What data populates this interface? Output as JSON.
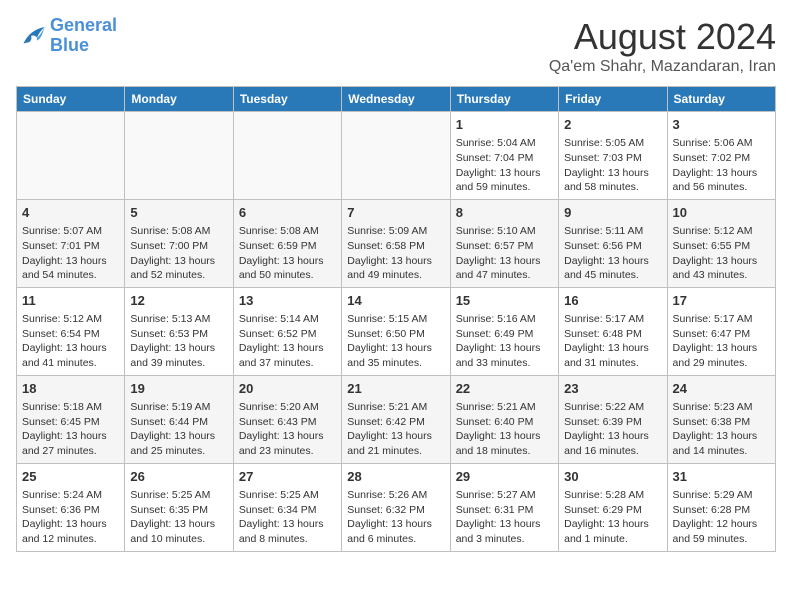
{
  "logo": {
    "line1": "General",
    "line2": "Blue"
  },
  "title": "August 2024",
  "location": "Qa'em Shahr, Mazandaran, Iran",
  "headers": [
    "Sunday",
    "Monday",
    "Tuesday",
    "Wednesday",
    "Thursday",
    "Friday",
    "Saturday"
  ],
  "weeks": [
    [
      {
        "day": "",
        "content": ""
      },
      {
        "day": "",
        "content": ""
      },
      {
        "day": "",
        "content": ""
      },
      {
        "day": "",
        "content": ""
      },
      {
        "day": "1",
        "content": "Sunrise: 5:04 AM\nSunset: 7:04 PM\nDaylight: 13 hours\nand 59 minutes."
      },
      {
        "day": "2",
        "content": "Sunrise: 5:05 AM\nSunset: 7:03 PM\nDaylight: 13 hours\nand 58 minutes."
      },
      {
        "day": "3",
        "content": "Sunrise: 5:06 AM\nSunset: 7:02 PM\nDaylight: 13 hours\nand 56 minutes."
      }
    ],
    [
      {
        "day": "4",
        "content": "Sunrise: 5:07 AM\nSunset: 7:01 PM\nDaylight: 13 hours\nand 54 minutes."
      },
      {
        "day": "5",
        "content": "Sunrise: 5:08 AM\nSunset: 7:00 PM\nDaylight: 13 hours\nand 52 minutes."
      },
      {
        "day": "6",
        "content": "Sunrise: 5:08 AM\nSunset: 6:59 PM\nDaylight: 13 hours\nand 50 minutes."
      },
      {
        "day": "7",
        "content": "Sunrise: 5:09 AM\nSunset: 6:58 PM\nDaylight: 13 hours\nand 49 minutes."
      },
      {
        "day": "8",
        "content": "Sunrise: 5:10 AM\nSunset: 6:57 PM\nDaylight: 13 hours\nand 47 minutes."
      },
      {
        "day": "9",
        "content": "Sunrise: 5:11 AM\nSunset: 6:56 PM\nDaylight: 13 hours\nand 45 minutes."
      },
      {
        "day": "10",
        "content": "Sunrise: 5:12 AM\nSunset: 6:55 PM\nDaylight: 13 hours\nand 43 minutes."
      }
    ],
    [
      {
        "day": "11",
        "content": "Sunrise: 5:12 AM\nSunset: 6:54 PM\nDaylight: 13 hours\nand 41 minutes."
      },
      {
        "day": "12",
        "content": "Sunrise: 5:13 AM\nSunset: 6:53 PM\nDaylight: 13 hours\nand 39 minutes."
      },
      {
        "day": "13",
        "content": "Sunrise: 5:14 AM\nSunset: 6:52 PM\nDaylight: 13 hours\nand 37 minutes."
      },
      {
        "day": "14",
        "content": "Sunrise: 5:15 AM\nSunset: 6:50 PM\nDaylight: 13 hours\nand 35 minutes."
      },
      {
        "day": "15",
        "content": "Sunrise: 5:16 AM\nSunset: 6:49 PM\nDaylight: 13 hours\nand 33 minutes."
      },
      {
        "day": "16",
        "content": "Sunrise: 5:17 AM\nSunset: 6:48 PM\nDaylight: 13 hours\nand 31 minutes."
      },
      {
        "day": "17",
        "content": "Sunrise: 5:17 AM\nSunset: 6:47 PM\nDaylight: 13 hours\nand 29 minutes."
      }
    ],
    [
      {
        "day": "18",
        "content": "Sunrise: 5:18 AM\nSunset: 6:45 PM\nDaylight: 13 hours\nand 27 minutes."
      },
      {
        "day": "19",
        "content": "Sunrise: 5:19 AM\nSunset: 6:44 PM\nDaylight: 13 hours\nand 25 minutes."
      },
      {
        "day": "20",
        "content": "Sunrise: 5:20 AM\nSunset: 6:43 PM\nDaylight: 13 hours\nand 23 minutes."
      },
      {
        "day": "21",
        "content": "Sunrise: 5:21 AM\nSunset: 6:42 PM\nDaylight: 13 hours\nand 21 minutes."
      },
      {
        "day": "22",
        "content": "Sunrise: 5:21 AM\nSunset: 6:40 PM\nDaylight: 13 hours\nand 18 minutes."
      },
      {
        "day": "23",
        "content": "Sunrise: 5:22 AM\nSunset: 6:39 PM\nDaylight: 13 hours\nand 16 minutes."
      },
      {
        "day": "24",
        "content": "Sunrise: 5:23 AM\nSunset: 6:38 PM\nDaylight: 13 hours\nand 14 minutes."
      }
    ],
    [
      {
        "day": "25",
        "content": "Sunrise: 5:24 AM\nSunset: 6:36 PM\nDaylight: 13 hours\nand 12 minutes."
      },
      {
        "day": "26",
        "content": "Sunrise: 5:25 AM\nSunset: 6:35 PM\nDaylight: 13 hours\nand 10 minutes."
      },
      {
        "day": "27",
        "content": "Sunrise: 5:25 AM\nSunset: 6:34 PM\nDaylight: 13 hours\nand 8 minutes."
      },
      {
        "day": "28",
        "content": "Sunrise: 5:26 AM\nSunset: 6:32 PM\nDaylight: 13 hours\nand 6 minutes."
      },
      {
        "day": "29",
        "content": "Sunrise: 5:27 AM\nSunset: 6:31 PM\nDaylight: 13 hours\nand 3 minutes."
      },
      {
        "day": "30",
        "content": "Sunrise: 5:28 AM\nSunset: 6:29 PM\nDaylight: 13 hours\nand 1 minute."
      },
      {
        "day": "31",
        "content": "Sunrise: 5:29 AM\nSunset: 6:28 PM\nDaylight: 12 hours\nand 59 minutes."
      }
    ]
  ]
}
